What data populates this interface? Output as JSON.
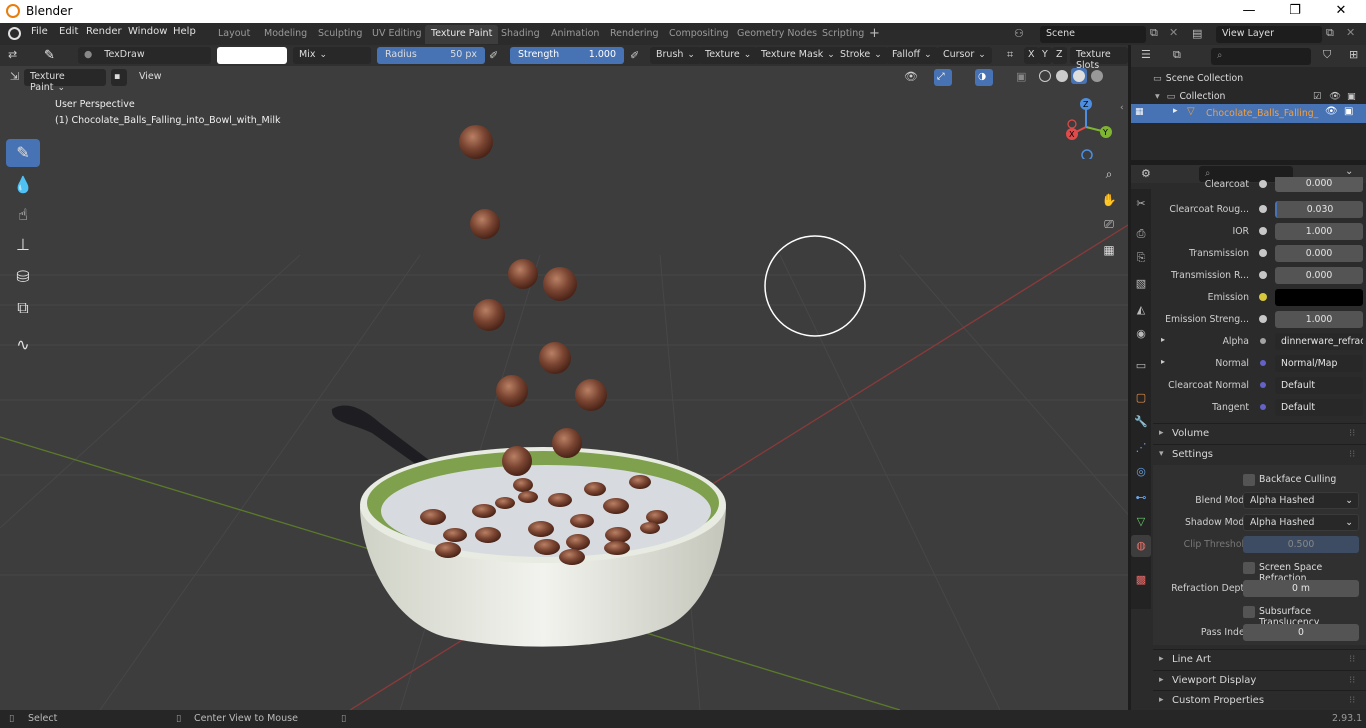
{
  "window": {
    "title": "Blender",
    "minimize": "—",
    "maximize": "❐",
    "close": "✕"
  },
  "menu": [
    "File",
    "Edit",
    "Render",
    "Window",
    "Help"
  ],
  "workspaces": [
    "Layout",
    "Modeling",
    "Sculpting",
    "UV Editing",
    "Texture Paint",
    "Shading",
    "Animation",
    "Rendering",
    "Compositing",
    "Geometry Nodes",
    "Scripting"
  ],
  "active_workspace": "Texture Paint",
  "scene": {
    "name": "Scene",
    "view_layer": "View Layer"
  },
  "tool_header": {
    "brush_name": "TexDraw",
    "blend": "Mix",
    "radius_label": "Radius",
    "radius_value": "50 px",
    "strength_label": "Strength",
    "strength_value": "1.000",
    "strength_fill": 1.0,
    "dropdowns": [
      "Brush",
      "Texture",
      "Texture Mask",
      "Stroke",
      "Falloff",
      "Cursor"
    ],
    "axes": [
      "X",
      "Y",
      "Z"
    ],
    "texture_slots": "Texture Slots"
  },
  "viewport_header": {
    "mode": "Texture Paint",
    "view": "View"
  },
  "viewport": {
    "perspective": "User Perspective",
    "object_info": "(1) Chocolate_Balls_Falling_into_Bowl_with_Milk"
  },
  "gizmo": {
    "x": "X",
    "y": "Y",
    "z": "Z"
  },
  "outliner": {
    "scene_collection": "Scene Collection",
    "collection": "Collection",
    "object": "Chocolate_Balls_Falling_"
  },
  "properties": {
    "rows": [
      {
        "label": "Clearcoat",
        "value": "0.000",
        "type": "number"
      },
      {
        "label": "Clearcoat Roug...",
        "value": "0.030",
        "type": "number"
      },
      {
        "label": "IOR",
        "value": "1.000",
        "type": "number"
      },
      {
        "label": "Transmission",
        "value": "0.000",
        "type": "number"
      },
      {
        "label": "Transmission R...",
        "value": "0.000",
        "type": "number"
      },
      {
        "label": "Emission",
        "value": "",
        "type": "color"
      },
      {
        "label": "Emission Streng...",
        "value": "1.000",
        "type": "number"
      },
      {
        "label": "Alpha",
        "value": "dinnerware_refracti...",
        "type": "link"
      },
      {
        "label": "Normal",
        "value": "Normal/Map",
        "type": "link"
      },
      {
        "label": "Clearcoat Normal",
        "value": "Default",
        "type": "plain"
      },
      {
        "label": "Tangent",
        "value": "Default",
        "type": "plain"
      }
    ],
    "panels": {
      "volume": "Volume",
      "settings": "Settings",
      "line_art": "Line Art",
      "viewport_display": "Viewport Display",
      "custom_properties": "Custom Properties"
    },
    "settings": {
      "backface_culling": "Backface Culling",
      "blend_mode_label": "Blend Mode",
      "blend_mode": "Alpha Hashed",
      "shadow_mode_label": "Shadow Mode",
      "shadow_mode": "Alpha Hashed",
      "clip_threshold_label": "Clip Threshold",
      "clip_threshold": "0.500",
      "screen_space_refraction": "Screen Space Refraction",
      "refraction_depth_label": "Refraction Depth",
      "refraction_depth": "0 m",
      "subsurface_translucency": "Subsurface Translucency",
      "pass_index_label": "Pass Index",
      "pass_index": "0"
    }
  },
  "statusbar": {
    "select": "Select",
    "center": "Center View to Mouse",
    "version": "2.93.1"
  },
  "colors": {
    "accent": "#4772b3",
    "background": "#3d3d3d",
    "panel": "#2b2b2b",
    "header": "#303030"
  }
}
